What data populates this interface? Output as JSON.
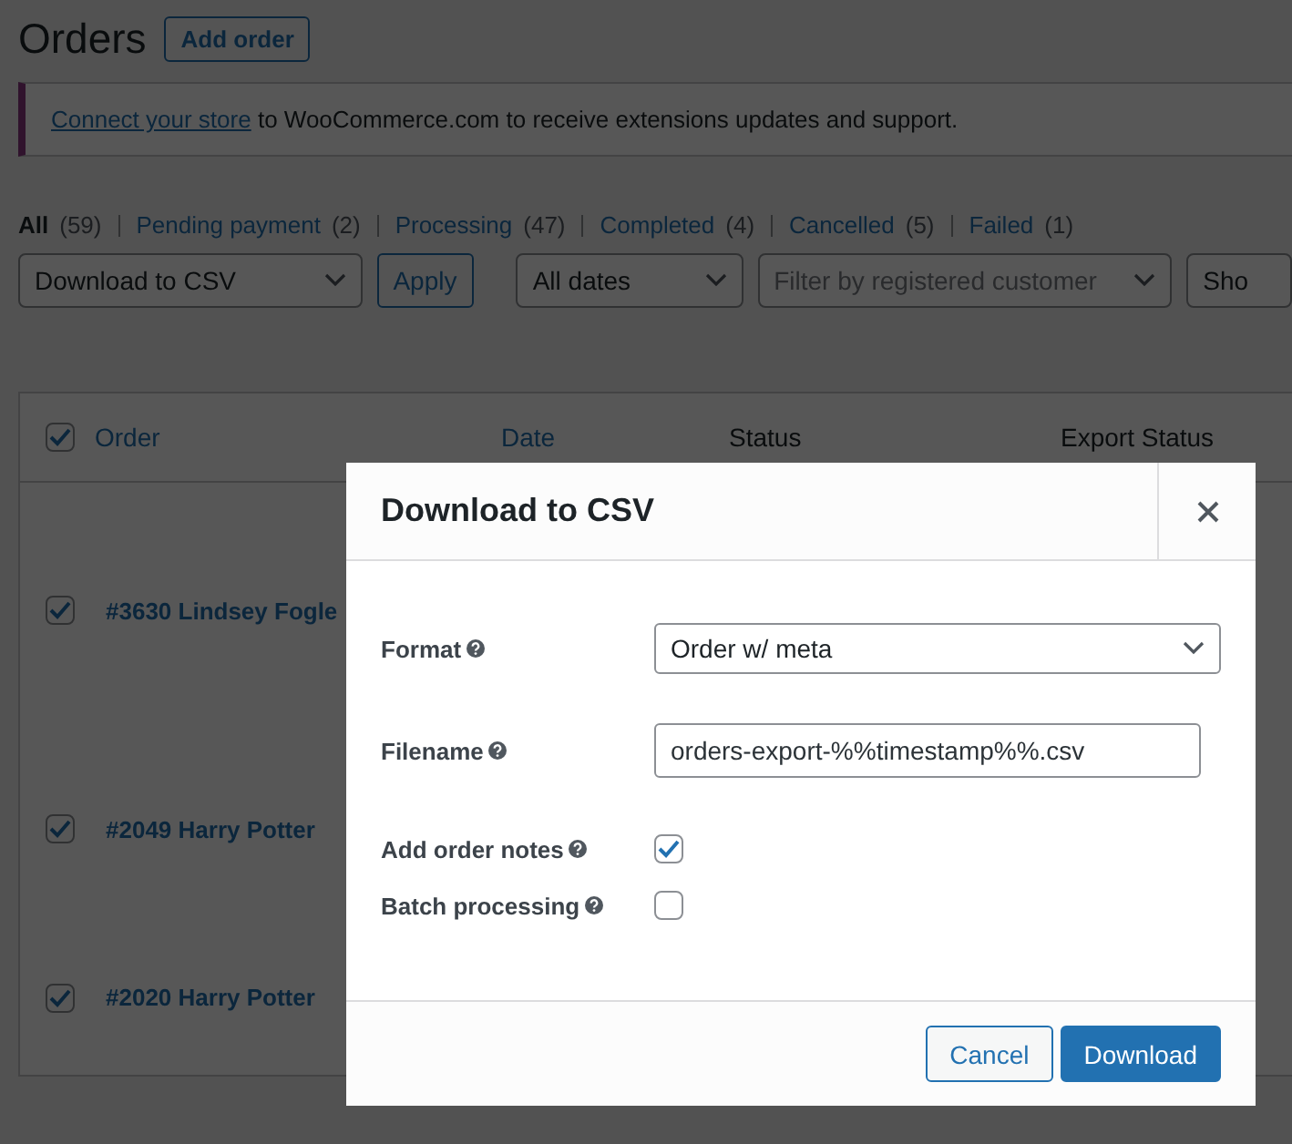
{
  "page": {
    "title": "Orders",
    "add_button": "Add order"
  },
  "notice": {
    "link": "Connect your store",
    "text": " to WooCommerce.com to receive extensions updates and support."
  },
  "status_filters": [
    {
      "label": "All",
      "count": "(59)",
      "selected": true
    },
    {
      "label": "Pending payment",
      "count": "(2)",
      "selected": false
    },
    {
      "label": "Processing",
      "count": "(47)",
      "selected": false
    },
    {
      "label": "Completed",
      "count": "(4)",
      "selected": false
    },
    {
      "label": "Cancelled",
      "count": "(5)",
      "selected": false
    },
    {
      "label": "Failed",
      "count": "(1)",
      "selected": false
    }
  ],
  "toolbar": {
    "bulk_action": "Download to CSV",
    "apply": "Apply",
    "dates": "All dates",
    "customer": {
      "placeholder": "Filter by registered customer"
    },
    "show_button": "Sho"
  },
  "table": {
    "select_all_checked": true,
    "columns": [
      {
        "label": "Order",
        "sortable": true
      },
      {
        "label": "Date",
        "sortable": true
      },
      {
        "label": "Status",
        "sortable": false
      },
      {
        "label": "Export Status",
        "sortable": false
      }
    ],
    "rows": [
      {
        "order": "#3630 Lindsey Fogle",
        "checked": true
      },
      {
        "order": "#2049 Harry Potter",
        "checked": true
      },
      {
        "order": "#2020 Harry Potter",
        "checked": true
      }
    ]
  },
  "dialog": {
    "title": "Download to CSV",
    "fields": [
      {
        "kind": "select",
        "label": "Format",
        "value": "Order w/ meta"
      },
      {
        "kind": "text",
        "label": "Filename",
        "value": "orders-export-%%timestamp%%.csv"
      },
      {
        "kind": "checkbox",
        "label": "Add order notes",
        "checked": true
      },
      {
        "kind": "checkbox",
        "label": "Batch processing",
        "checked": false
      }
    ],
    "buttons": [
      {
        "label": "Cancel",
        "primary": false
      },
      {
        "label": "Download",
        "primary": true
      }
    ]
  }
}
